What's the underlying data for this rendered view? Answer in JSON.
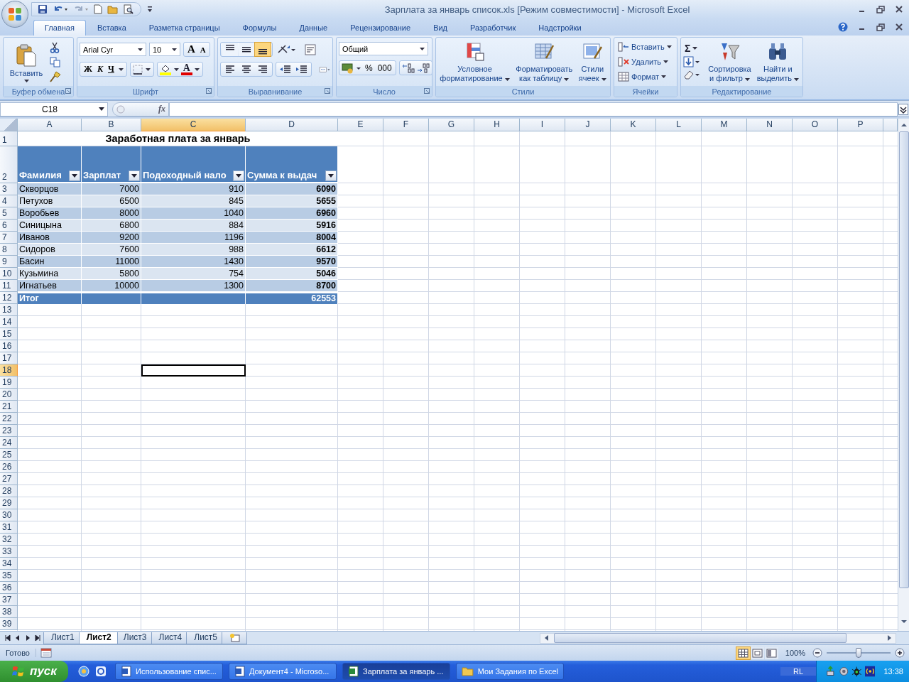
{
  "window": {
    "title": "Зарплата за январь список.xls  [Режим совместимости] - Microsoft Excel"
  },
  "ribbon_tabs": [
    {
      "label": "Главная",
      "selected": true
    },
    {
      "label": "Вставка",
      "selected": false
    },
    {
      "label": "Разметка страницы",
      "selected": false
    },
    {
      "label": "Формулы",
      "selected": false
    },
    {
      "label": "Данные",
      "selected": false
    },
    {
      "label": "Рецензирование",
      "selected": false
    },
    {
      "label": "Вид",
      "selected": false
    },
    {
      "label": "Разработчик",
      "selected": false
    },
    {
      "label": "Надстройки",
      "selected": false
    }
  ],
  "ribbon": {
    "clipboard": {
      "label": "Буфер обмена",
      "paste": "Вставить"
    },
    "font": {
      "label": "Шрифт",
      "font_name": "Arial Cyr",
      "font_size": "10",
      "grow": "A",
      "shrink": "A",
      "bold": "Ж",
      "italic": "К",
      "underline": "Ч",
      "font_color": "A"
    },
    "alignment": {
      "label": "Выравнивание",
      "vertical": [
        {
          "kind": "top",
          "selected": false
        },
        {
          "kind": "middle",
          "selected": false
        },
        {
          "kind": "bottom",
          "selected": true
        }
      ]
    },
    "number": {
      "label": "Число",
      "format": "Общий",
      "percent": "%",
      "thousands": "000"
    },
    "styles": {
      "label": "Стили",
      "buttons": [
        {
          "kind": "conditional",
          "lines": [
            "Условное",
            "форматирование"
          ]
        },
        {
          "kind": "table",
          "lines": [
            "Форматировать",
            "как таблицу"
          ]
        },
        {
          "kind": "cell",
          "lines": [
            "Стили",
            "ячеек"
          ]
        }
      ]
    },
    "cells": {
      "label": "Ячейки",
      "buttons": [
        {
          "kind": "insert",
          "label": "Вставить"
        },
        {
          "kind": "delete",
          "label": "Удалить"
        },
        {
          "kind": "format",
          "label": "Формат"
        }
      ]
    },
    "editing": {
      "label": "Редактирование",
      "sum": "Σ",
      "buttons": [
        {
          "kind": "sort",
          "lines": [
            "Сортировка",
            "и фильтр"
          ]
        },
        {
          "kind": "find",
          "lines": [
            "Найти и",
            "выделить"
          ]
        }
      ]
    }
  },
  "formula_bar": {
    "name_box": "C18",
    "fx": "fx"
  },
  "sheet": {
    "columns": [
      {
        "label": "A",
        "selected": false
      },
      {
        "label": "B",
        "selected": false
      },
      {
        "label": "C",
        "selected": true
      },
      {
        "label": "D",
        "selected": false
      },
      {
        "label": "E",
        "selected": false
      },
      {
        "label": "F",
        "selected": false
      },
      {
        "label": "G",
        "selected": false
      },
      {
        "label": "H",
        "selected": false
      },
      {
        "label": "I",
        "selected": false
      },
      {
        "label": "J",
        "selected": false
      },
      {
        "label": "K",
        "selected": false
      },
      {
        "label": "L",
        "selected": false
      },
      {
        "label": "M",
        "selected": false
      },
      {
        "label": "N",
        "selected": false
      },
      {
        "label": "O",
        "selected": false
      },
      {
        "label": "P",
        "selected": false
      }
    ],
    "rows": [
      {
        "label": "1",
        "selected": false
      },
      {
        "label": "2",
        "selected": false
      },
      {
        "label": "3",
        "selected": false
      },
      {
        "label": "4",
        "selected": false
      },
      {
        "label": "5",
        "selected": false
      },
      {
        "label": "6",
        "selected": false
      },
      {
        "label": "7",
        "selected": false
      },
      {
        "label": "8",
        "selected": false
      },
      {
        "label": "9",
        "selected": false
      },
      {
        "label": "10",
        "selected": false
      },
      {
        "label": "11",
        "selected": false
      },
      {
        "label": "12",
        "selected": false
      },
      {
        "label": "13",
        "selected": false
      },
      {
        "label": "14",
        "selected": false
      },
      {
        "label": "15",
        "selected": false
      },
      {
        "label": "16",
        "selected": false
      },
      {
        "label": "17",
        "selected": false
      },
      {
        "label": "18",
        "selected": true
      },
      {
        "label": "19",
        "selected": false
      },
      {
        "label": "20",
        "selected": false
      },
      {
        "label": "21",
        "selected": false
      },
      {
        "label": "22",
        "selected": false
      },
      {
        "label": "23",
        "selected": false
      },
      {
        "label": "24",
        "selected": false
      },
      {
        "label": "25",
        "selected": false
      },
      {
        "label": "26",
        "selected": false
      },
      {
        "label": "27",
        "selected": false
      },
      {
        "label": "28",
        "selected": false
      },
      {
        "label": "29",
        "selected": false
      },
      {
        "label": "30",
        "selected": false
      },
      {
        "label": "31",
        "selected": false
      },
      {
        "label": "32",
        "selected": false
      },
      {
        "label": "33",
        "selected": false
      },
      {
        "label": "34",
        "selected": false
      },
      {
        "label": "35",
        "selected": false
      },
      {
        "label": "36",
        "selected": false
      },
      {
        "label": "37",
        "selected": false
      },
      {
        "label": "38",
        "selected": false
      },
      {
        "label": "39",
        "selected": false
      }
    ],
    "title": "Заработная плата за январь",
    "headers": [
      "Фамилия",
      "Зарплат",
      "Подоходный нало",
      "Сумма к выдач"
    ],
    "data": [
      [
        "Скворцов",
        "7000",
        "910",
        "6090"
      ],
      [
        "Петухов",
        "6500",
        "845",
        "5655"
      ],
      [
        "Воробьев",
        "8000",
        "1040",
        "6960"
      ],
      [
        "Синицына",
        "6800",
        "884",
        "5916"
      ],
      [
        "Иванов",
        "9200",
        "1196",
        "8004"
      ],
      [
        "Сидоров",
        "7600",
        "988",
        "6612"
      ],
      [
        "Басин",
        "11000",
        "1430",
        "9570"
      ],
      [
        "Кузьмина",
        "5800",
        "754",
        "5046"
      ],
      [
        "Игнатьев",
        "10000",
        "1300",
        "8700"
      ]
    ],
    "total": {
      "label": "Итог",
      "value": "62553"
    }
  },
  "sheet_tabs": [
    {
      "label": "Лист1",
      "selected": false
    },
    {
      "label": "Лист2",
      "selected": true
    },
    {
      "label": "Лист3",
      "selected": false
    },
    {
      "label": "Лист4",
      "selected": false
    },
    {
      "label": "Лист5",
      "selected": false
    }
  ],
  "status_bar": {
    "status": "Готово",
    "views": [
      {
        "kind": "normal",
        "selected": true
      },
      {
        "kind": "page_layout",
        "selected": false
      },
      {
        "kind": "page_break",
        "selected": false
      }
    ],
    "zoom": "100%",
    "zoom_slider": {
      "level": 0.5
    }
  },
  "taskbar": {
    "start": "пуск",
    "tasks": [
      {
        "kind": "word",
        "label": "Использование спис...",
        "selected": false
      },
      {
        "kind": "word",
        "label": "Документ4 - Microso...",
        "selected": false
      },
      {
        "kind": "excel",
        "label": "Зарплата за январь ...",
        "selected": true
      },
      {
        "kind": "folder",
        "label": "Мои Задания по Excel",
        "selected": false
      }
    ],
    "language": "RL",
    "clock": "13:38"
  }
}
